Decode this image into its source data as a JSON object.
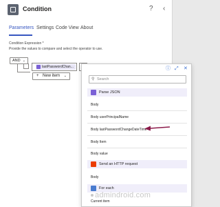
{
  "header": {
    "title": "Condition",
    "help_icon": "?",
    "collapse_icon": "‹"
  },
  "tabs": [
    {
      "label": "Parameters",
      "active": true
    },
    {
      "label": "Settings",
      "active": false
    },
    {
      "label": "Code View",
      "active": false
    },
    {
      "label": "About",
      "active": false
    }
  ],
  "condition": {
    "label": "Condition Expression *",
    "instruction": "Provide the values to compare and select the operator to use.",
    "group_operator": "AND",
    "token_label": "lastPasswordChan...",
    "new_item_label": "New item"
  },
  "picker": {
    "search_placeholder": "Search",
    "sections": [
      {
        "title": "Parse JSON",
        "icon_color": "#7b61d6",
        "items": [
          "Body",
          "Body userPrincipalName",
          "Body lastPasswordChangeDateTime",
          "Body Item",
          "Body value"
        ]
      },
      {
        "title": "Send an HTTP request",
        "icon_color": "#eb3c00",
        "items": [
          "Body"
        ]
      },
      {
        "title": "For each",
        "icon_color": "#4a7ccf",
        "items": [
          "Current item"
        ]
      }
    ]
  },
  "watermark": "admindroid.com",
  "colors": {
    "accent": "#3656c0",
    "annotation_arrow": "#8b1a4a"
  }
}
